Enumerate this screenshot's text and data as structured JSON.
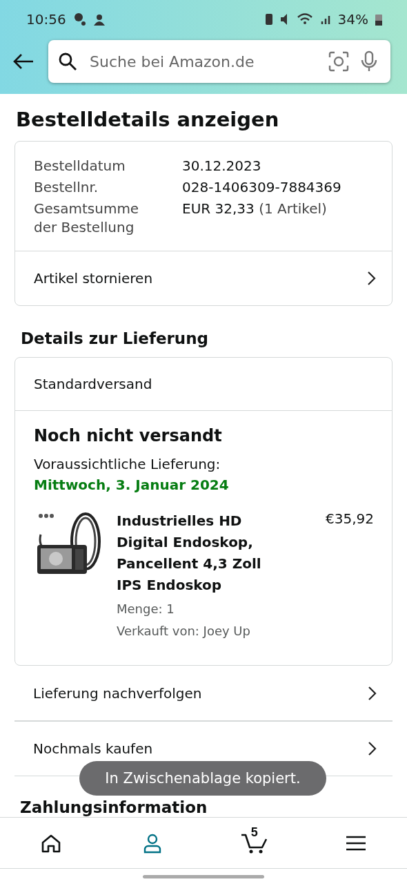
{
  "status_bar": {
    "time": "10:56",
    "battery": "34%"
  },
  "search": {
    "placeholder": "Suche bei Amazon.de"
  },
  "title": "Bestelldetails anzeigen",
  "order": {
    "fields": [
      {
        "label": "Bestelldatum",
        "value": "30.12.2023"
      },
      {
        "label": "Bestellnr.",
        "value": "028-1406309-7884369"
      },
      {
        "label": "Gesamtsumme der Bestellung",
        "value": "EUR 32,33",
        "note": "(1 Artikel)"
      }
    ],
    "action": "Artikel stornieren"
  },
  "delivery": {
    "heading": "Details zur Lieferung",
    "method": "Standardversand",
    "status": "Noch nicht versandt",
    "eta_label": "Voraussichtliche Lieferung:",
    "eta_date": "Mittwoch, 3. Januar 2024",
    "item": {
      "name": "Industrielles HD Digital Endoskop, Pancellent 4,3 Zoll IPS Endoskop",
      "price": "€35,92",
      "quantity": "Menge: 1",
      "seller": "Verkauft von: Joey Up"
    }
  },
  "links": [
    "Lieferung nachverfolgen",
    "Nochmals kaufen"
  ],
  "payment_heading": "Zahlungsinformation",
  "toast": "In Zwischenablage kopiert.",
  "nav": [
    {
      "kind": "home",
      "selected": false
    },
    {
      "kind": "account",
      "selected": true
    },
    {
      "kind": "cart",
      "selected": false,
      "count": "5"
    },
    {
      "kind": "menu",
      "selected": false
    }
  ]
}
